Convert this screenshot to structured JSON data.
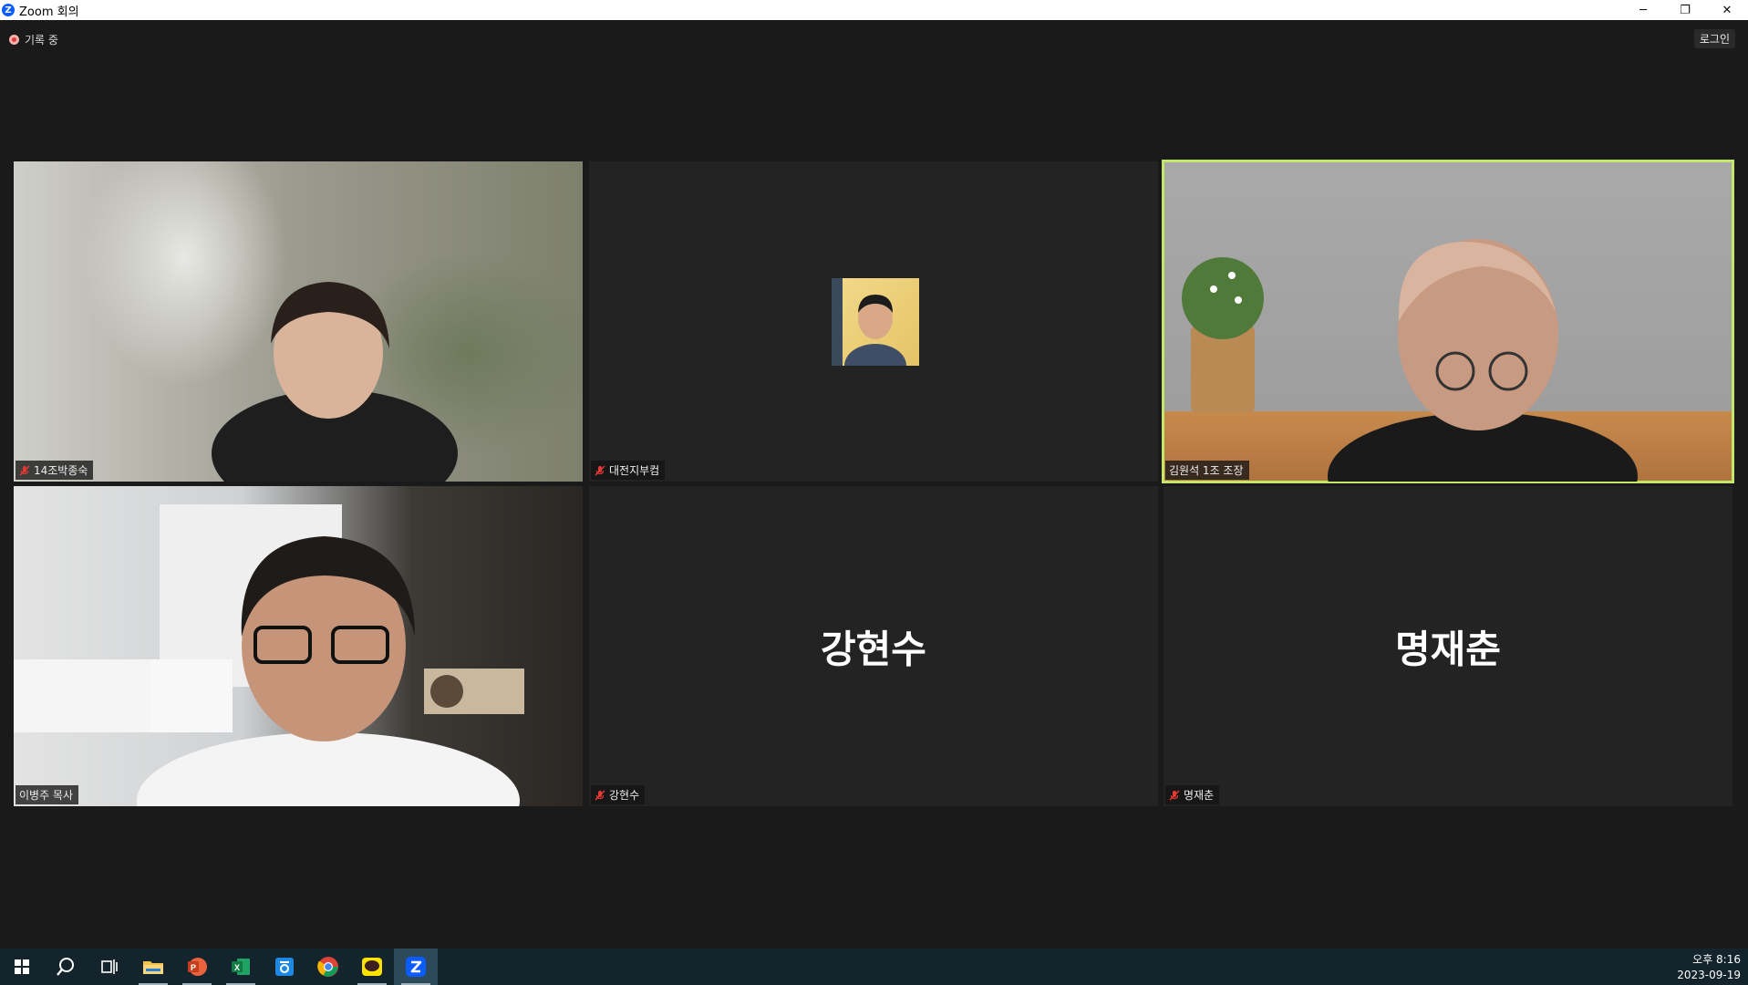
{
  "window": {
    "title": "Zoom 회의",
    "app_icon_glyph": "Z",
    "minimize_glyph": "─",
    "restore_glyph": "❐",
    "close_glyph": "✕"
  },
  "meeting": {
    "recording_label": "기록 중",
    "login_label": "로그인"
  },
  "participants": [
    {
      "name": "14조박종숙",
      "muted": true,
      "video": true
    },
    {
      "name": "대전지부컴",
      "muted": true,
      "video": false,
      "has_photo": true
    },
    {
      "name": "김원석 1조 조장",
      "muted": false,
      "video": true,
      "active_speaker": true
    },
    {
      "name": "이병주 목사",
      "muted": false,
      "video": true
    },
    {
      "name": "강현수",
      "muted": true,
      "video": false
    },
    {
      "name": "명재춘",
      "muted": true,
      "video": false
    }
  ],
  "taskbar": {
    "apps": [
      {
        "name": "start-icon"
      },
      {
        "name": "search-icon"
      },
      {
        "name": "task-view-icon"
      },
      {
        "name": "file-explorer-icon"
      },
      {
        "name": "powerpoint-icon"
      },
      {
        "name": "excel-icon"
      },
      {
        "name": "hancom-icon"
      },
      {
        "name": "chrome-icon"
      },
      {
        "name": "kakaotalk-icon"
      },
      {
        "name": "zoom-icon"
      }
    ],
    "time": "오후 8:16",
    "date": "2023-09-19"
  },
  "colors": {
    "active_speaker_border": "#c3e66b",
    "mute_red": "#e53935",
    "taskbar_bg": "#13242d",
    "zoom_blue": "#0b5cff"
  }
}
